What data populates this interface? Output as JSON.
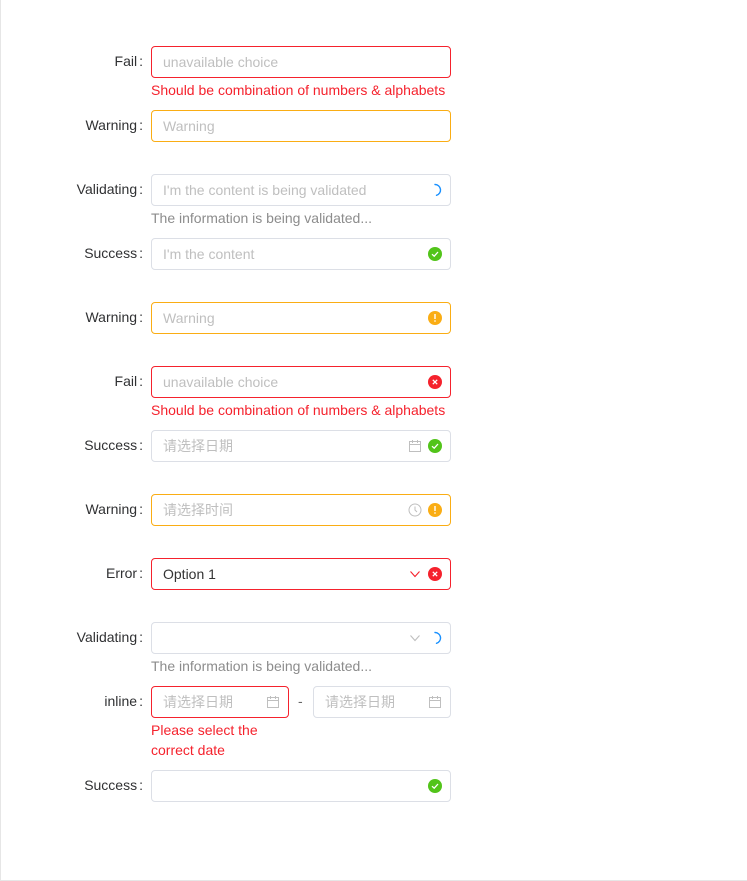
{
  "form": {
    "colon": ":",
    "rows": [
      {
        "label": "Fail",
        "placeholder": "unavailable choice",
        "status": "error",
        "message": "Should be combination of numbers & alphabets"
      },
      {
        "label": "Warning",
        "placeholder": "Warning",
        "status": "warning"
      },
      {
        "label": "Validating",
        "placeholder": "I'm the content is being validated",
        "status": "validating",
        "message": "The information is being validated..."
      },
      {
        "label": "Success",
        "placeholder": "I'm the content",
        "status": "success"
      },
      {
        "label": "Warning",
        "placeholder": "Warning",
        "status": "warning"
      },
      {
        "label": "Fail",
        "placeholder": "unavailable choice",
        "status": "error",
        "message": "Should be combination of numbers & alphabets"
      },
      {
        "label": "Success",
        "placeholder": "请选择日期",
        "status": "success",
        "icon": "calendar-icon"
      },
      {
        "label": "Warning",
        "placeholder": "请选择时间",
        "status": "warning",
        "icon": "clock-icon"
      },
      {
        "label": "Error",
        "value": "Option 1",
        "status": "error",
        "icon": "chevron-down-icon"
      },
      {
        "label": "Validating",
        "value": "",
        "status": "validating",
        "icon": "chevron-down-icon",
        "message": "The information is being validated..."
      },
      {
        "label": "inline",
        "start_placeholder": "请选择日期",
        "end_placeholder": "请选择日期",
        "separator": "-",
        "status": "error",
        "message_line1": "Please select the",
        "message_line2": "correct date"
      },
      {
        "label": "Success",
        "value": "",
        "status": "success"
      }
    ]
  },
  "colors": {
    "error": "#f5222d",
    "warning": "#faad14",
    "success": "#52c41a",
    "validating": "#1890ff",
    "border": "#dcdfe6"
  }
}
